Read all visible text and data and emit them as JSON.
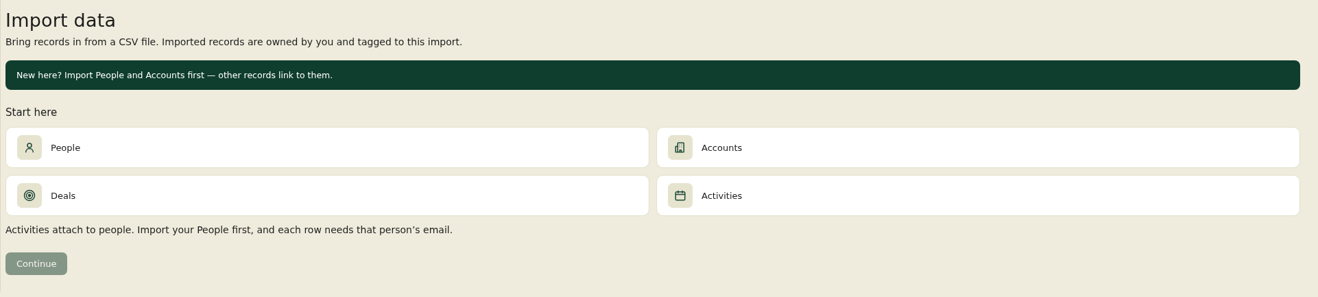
{
  "title": "Import data",
  "subtitle": "Bring records in from a CSV file. Imported records are owned by you and tagged to this import.",
  "banner": "New here? Import People and Accounts first — other records link to them.",
  "section_title": "Start here",
  "record_types": [
    {
      "label": "People"
    },
    {
      "label": "Accounts"
    },
    {
      "label": "Deals"
    },
    {
      "label": "Activities"
    }
  ],
  "note": "Activities attach to people. Import your People first, and each row needs that person’s email.",
  "continue_button": {
    "label": "Continue",
    "disabled": true
  }
}
